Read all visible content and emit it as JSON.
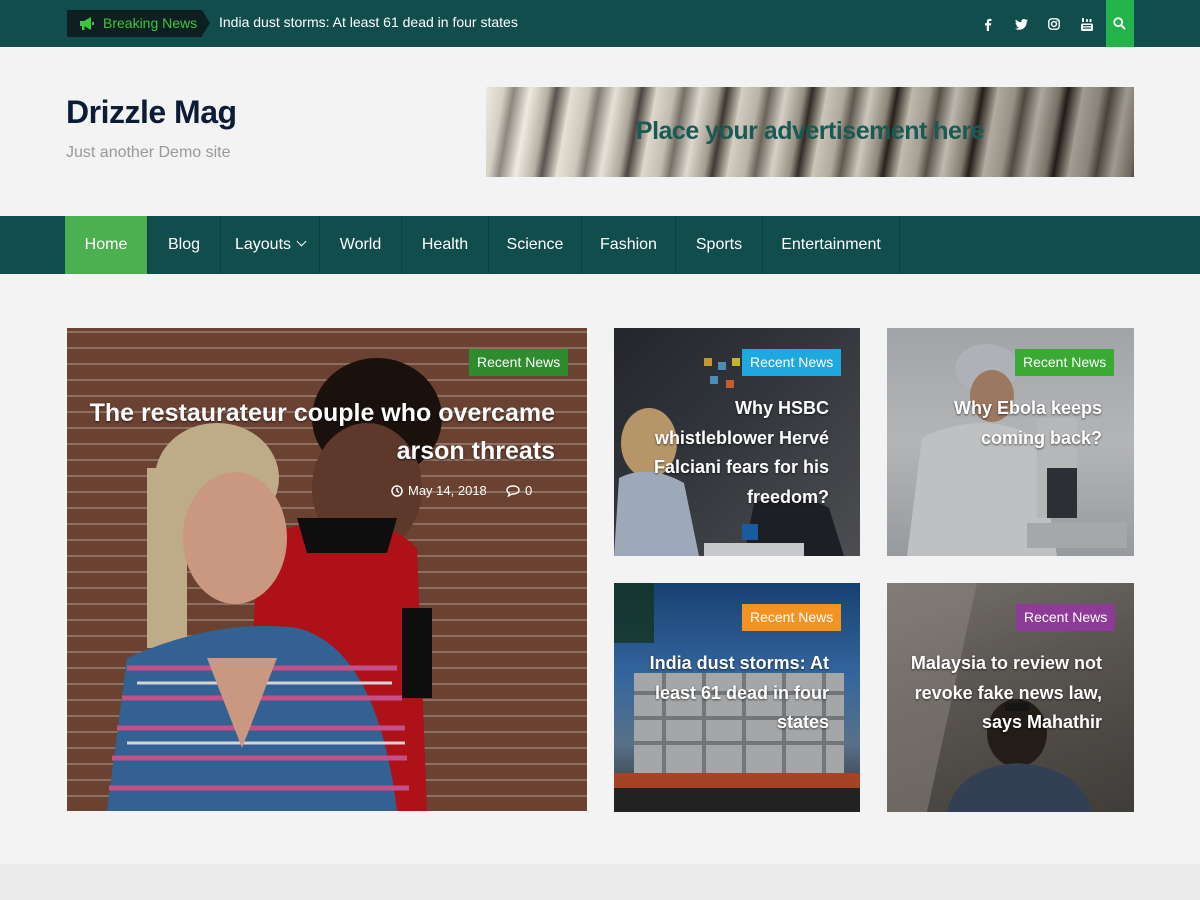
{
  "topbar": {
    "breaking_label": "Breaking News",
    "breaking_text": "India dust storms: At least 61 dead in four states",
    "social_icons": [
      "facebook-icon",
      "twitter-icon",
      "instagram-icon",
      "youtube-icon"
    ],
    "search_icon": "search-icon"
  },
  "header": {
    "site_title": "Drizzle Mag",
    "site_description": "Just another Demo site",
    "ad_text": "Place your advertisement here"
  },
  "nav": {
    "items": [
      {
        "label": "Home",
        "active": true
      },
      {
        "label": "Blog"
      },
      {
        "label": "Layouts",
        "has_dropdown": true
      },
      {
        "label": "World"
      },
      {
        "label": "Health"
      },
      {
        "label": "Science"
      },
      {
        "label": "Fashion"
      },
      {
        "label": "Sports"
      },
      {
        "label": "Entertainment"
      }
    ]
  },
  "featured": {
    "badge": "Recent News",
    "badge_color": "#2e8b2e",
    "title": "The restaurateur couple who overcame arson threats",
    "date": "May 14, 2018",
    "comments": "0"
  },
  "cards": [
    {
      "badge": "Recent News",
      "badge_color": "#1fa8e0",
      "title": "Why HSBC whistleblower Hervé Falciani fears for his freedom?"
    },
    {
      "badge": "Recent News",
      "badge_color": "#3aaa35",
      "title": "Why Ebola keeps coming back?"
    },
    {
      "badge": "Recent News",
      "badge_color": "#f39322",
      "title": "India dust storms: At least 61 dead in four states"
    },
    {
      "badge": "Recent News",
      "badge_color": "#8e3a97",
      "title": "Malaysia to review not revoke fake news law, says Mahathir"
    }
  ],
  "colors": {
    "primary": "#124d4d",
    "accent_green": "#4caf50",
    "search_green": "#24b24b",
    "breaking_green": "#3cc63c"
  }
}
